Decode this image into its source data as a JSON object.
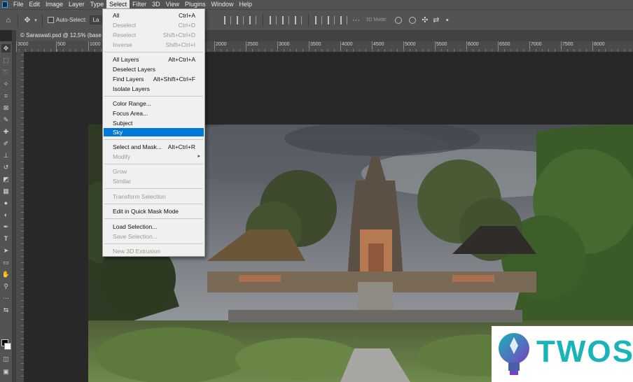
{
  "menubar": {
    "items": [
      "File",
      "Edit",
      "Image",
      "Layer",
      "Type",
      "Select",
      "Filter",
      "3D",
      "View",
      "Plugins",
      "Window",
      "Help"
    ],
    "active": "Select"
  },
  "options_bar": {
    "auto_select_label": "Auto-Select:",
    "layer_dropdown_value": "La",
    "mode_3d_label": "3D Mode:"
  },
  "document_tab": {
    "title": "© Saraswati.psd @ 12,5% (base"
  },
  "ruler": {
    "top_labels": [
      "3000",
      "500",
      "1000",
      "2000",
      "2500",
      "3000",
      "3500",
      "4000",
      "4500",
      "5000",
      "5500",
      "6000",
      "6500",
      "7000",
      "7500",
      "8000"
    ]
  },
  "select_menu": {
    "items": [
      {
        "label": "All",
        "shortcut": "Ctrl+A",
        "enabled": true
      },
      {
        "label": "Deselect",
        "shortcut": "Ctrl+D",
        "enabled": false
      },
      {
        "label": "Reselect",
        "shortcut": "Shift+Ctrl+D",
        "enabled": false
      },
      {
        "label": "Inverse",
        "shortcut": "Shift+Ctrl+I",
        "enabled": false
      },
      {
        "label": "All Layers",
        "shortcut": "Alt+Ctrl+A",
        "enabled": true
      },
      {
        "label": "Deselect Layers",
        "shortcut": "",
        "enabled": true
      },
      {
        "label": "Find Layers",
        "shortcut": "Alt+Shift+Ctrl+F",
        "enabled": true
      },
      {
        "label": "Isolate Layers",
        "shortcut": "",
        "enabled": true
      },
      {
        "label": "Color Range...",
        "shortcut": "",
        "enabled": true
      },
      {
        "label": "Focus Area...",
        "shortcut": "",
        "enabled": true
      },
      {
        "label": "Subject",
        "shortcut": "",
        "enabled": true
      },
      {
        "label": "Sky",
        "shortcut": "",
        "enabled": true,
        "highlighted": true
      },
      {
        "label": "Select and Mask...",
        "shortcut": "Alt+Ctrl+R",
        "enabled": true
      },
      {
        "label": "Modify",
        "shortcut": "",
        "enabled": false,
        "submenu": true
      },
      {
        "label": "Grow",
        "shortcut": "",
        "enabled": false
      },
      {
        "label": "Similar",
        "shortcut": "",
        "enabled": false
      },
      {
        "label": "Transform Selection",
        "shortcut": "",
        "enabled": false
      },
      {
        "label": "Edit in Quick Mask Mode",
        "shortcut": "",
        "enabled": true
      },
      {
        "label": "Load Selection...",
        "shortcut": "",
        "enabled": true
      },
      {
        "label": "Save Selection...",
        "shortcut": "",
        "enabled": false
      },
      {
        "label": "New 3D Extrusion",
        "shortcut": "",
        "enabled": false
      }
    ],
    "submenu_arrow": "▸"
  },
  "watermark": {
    "brand": "TWOS"
  },
  "colors": {
    "app_bg": "#535353",
    "canvas_bg": "#282828",
    "menu_highlight": "#0078d7",
    "brand_teal": "#17b5b8"
  }
}
